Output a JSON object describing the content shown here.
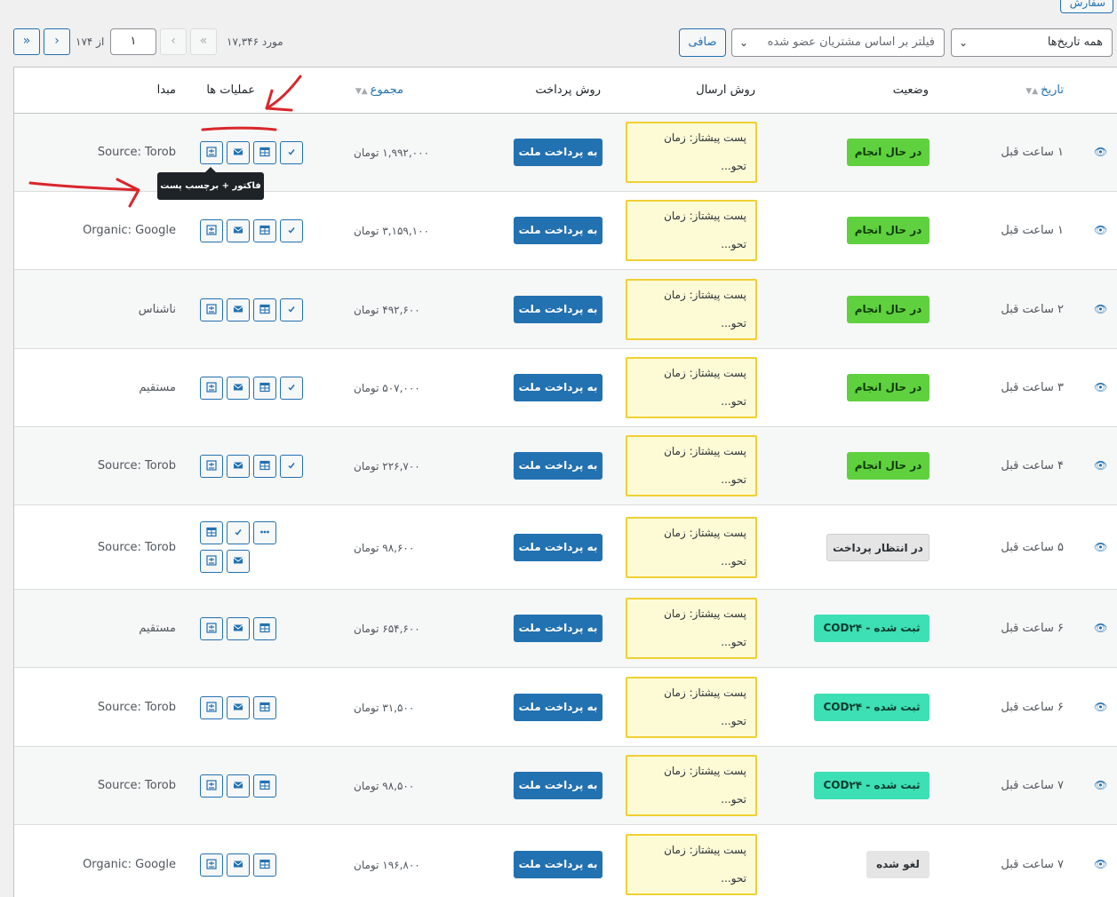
{
  "top_tab": {
    "label": "سفارش ها"
  },
  "filters": {
    "dates": {
      "value": "همه تاریخ‌ها"
    },
    "customer": {
      "placeholder": "فیلتر بر اساس مشتریان عضو شده"
    },
    "filter_button": "صافی"
  },
  "pagination": {
    "items_count": "۱۷,۳۴۶ مورد",
    "first": "«",
    "prev": "‹",
    "current_page": "۱",
    "of_label": "از ۱۷۴",
    "next": "›",
    "last": "»"
  },
  "columns": {
    "date": "تاریخ",
    "status": "وضعیت",
    "shipping": "روش ارسال",
    "payment": "روش پرداخت",
    "total": "مجموع",
    "actions": "عملیات ها",
    "origin": "مبدا"
  },
  "tooltip": "فاکتور + برچسب پست",
  "orders": [
    {
      "date": "۱ ساعت قبل",
      "status": "در حال انجام",
      "status_type": "processing",
      "ship_line1": "پست پیشتاز: زمان",
      "ship_line2": "تحو...",
      "payment": "به پرداخت ملت",
      "total": "۱,۹۹۲,۰۰۰ تومان",
      "origin": "Source: Torob"
    },
    {
      "date": "۱ ساعت قبل",
      "status": "در حال انجام",
      "status_type": "processing",
      "ship_line1": "پست پیشتاز: زمان",
      "ship_line2": "تحو...",
      "payment": "به پرداخت ملت",
      "total": "۳,۱۵۹,۱۰۰ تومان",
      "origin": "Organic: Google"
    },
    {
      "date": "۲ ساعت قبل",
      "status": "در حال انجام",
      "status_type": "processing",
      "ship_line1": "پست پیشتاز: زمان",
      "ship_line2": "تحو...",
      "payment": "به پرداخت ملت",
      "total": "۴۹۲,۶۰۰ تومان",
      "origin": "ناشناس"
    },
    {
      "date": "۳ ساعت قبل",
      "status": "در حال انجام",
      "status_type": "processing",
      "ship_line1": "پست پیشتاز: زمان",
      "ship_line2": "تحو...",
      "payment": "به پرداخت ملت",
      "total": "۵۰۷,۰۰۰ تومان",
      "origin": "مستقیم"
    },
    {
      "date": "۴ ساعت قبل",
      "status": "در حال انجام",
      "status_type": "processing",
      "ship_line1": "پست پیشتاز: زمان",
      "ship_line2": "تحو...",
      "payment": "به پرداخت ملت",
      "total": "۲۲۶,۷۰۰ تومان",
      "origin": "Source: Torob"
    },
    {
      "date": "۵ ساعت قبل",
      "status": "در انتظار پرداخت",
      "status_type": "pending",
      "ship_line1": "پست پیشتاز: زمان",
      "ship_line2": "تحو...",
      "payment": "به پرداخت ملت",
      "total": "۹۸,۶۰۰ تومان",
      "origin": "Source: Torob"
    },
    {
      "date": "۶ ساعت قبل",
      "status": "ثبت شده - COD۲۴",
      "status_type": "cod",
      "ship_line1": "پست پیشتاز: زمان",
      "ship_line2": "تحو...",
      "payment": "به پرداخت ملت",
      "total": "۶۵۴,۶۰۰ تومان",
      "origin": "مستقیم"
    },
    {
      "date": "۶ ساعت قبل",
      "status": "ثبت شده - COD۲۴",
      "status_type": "cod",
      "ship_line1": "پست پیشتاز: زمان",
      "ship_line2": "تحو...",
      "payment": "به پرداخت ملت",
      "total": "۳۱,۵۰۰ تومان",
      "origin": "Source: Torob"
    },
    {
      "date": "۷ ساعت قبل",
      "status": "ثبت شده - COD۲۴",
      "status_type": "cod",
      "ship_line1": "پست پیشتاز: زمان",
      "ship_line2": "تحو...",
      "payment": "به پرداخت ملت",
      "total": "۹۸,۵۰۰ تومان",
      "origin": "Source: Torob"
    },
    {
      "date": "۷ ساعت قبل",
      "status": "لغو شده",
      "status_type": "cancelled",
      "ship_line1": "پست پیشتاز: زمان",
      "ship_line2": "تحو...",
      "payment": "به پرداخت ملت",
      "total": "۱۹۶,۸۰۰ تومان",
      "origin": "Organic: Google"
    }
  ],
  "colors": {
    "accent": "#2271b1",
    "processing": "#5fd13e",
    "cod": "#3ddfb4",
    "shipping_bg": "#fdfbd6",
    "shipping_border": "#f0d033",
    "annotation": "#d9262b"
  }
}
